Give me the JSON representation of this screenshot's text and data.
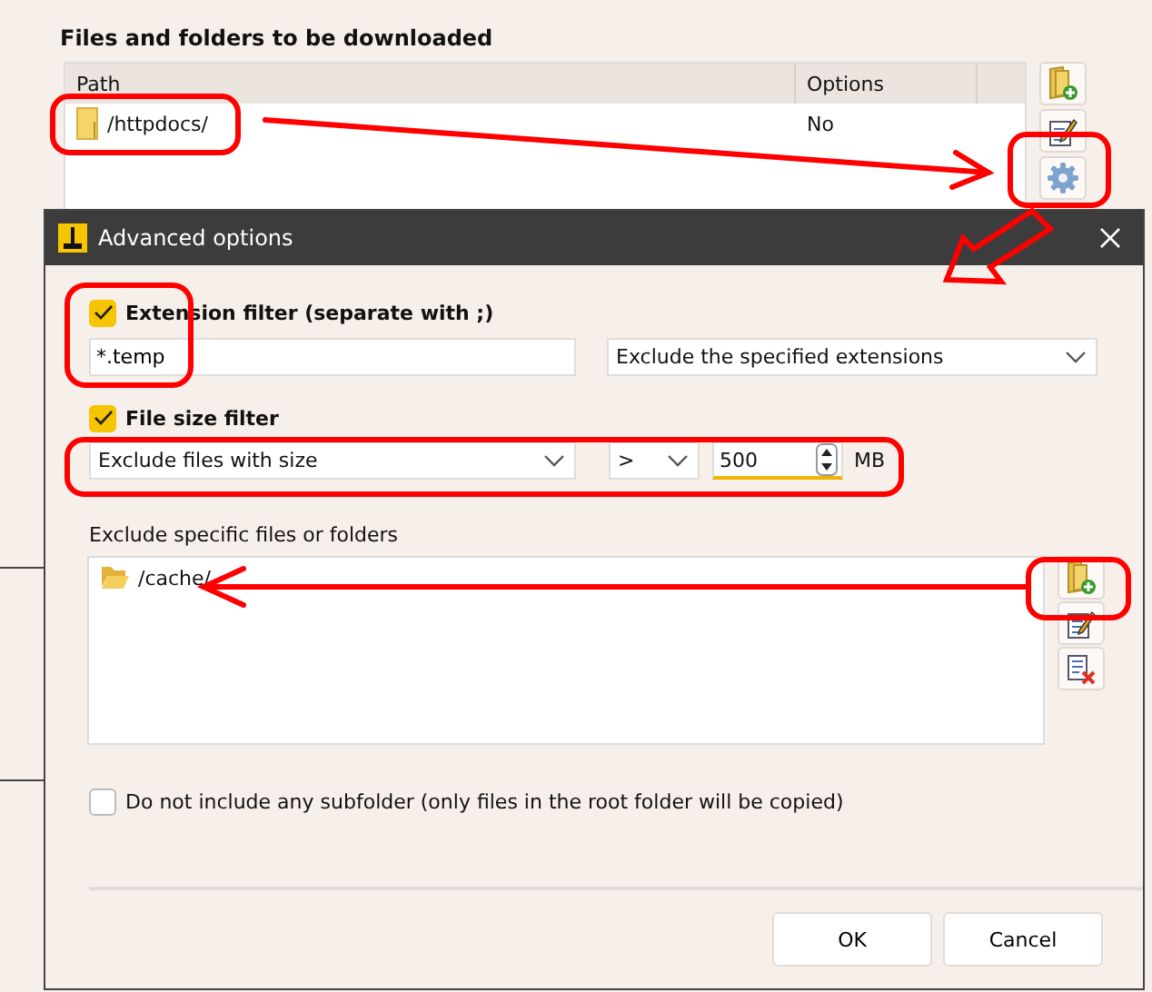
{
  "background_window": {
    "section_title": "Files and folders to be downloaded",
    "table": {
      "columns": [
        "Path",
        "Options"
      ],
      "rows": [
        {
          "path": "/httpdocs/",
          "options": "No"
        }
      ]
    }
  },
  "dialog": {
    "title": "Advanced options",
    "extension_filter": {
      "label": "Extension filter (separate with ;)",
      "checked": true,
      "value": "*.temp",
      "mode": "Exclude the specified extensions"
    },
    "size_filter": {
      "label": "File size filter",
      "checked": true,
      "mode": "Exclude files with size",
      "operator": ">",
      "value": "500",
      "unit": "MB"
    },
    "exclusions": {
      "label": "Exclude specific files or folders",
      "items": [
        {
          "path": "/cache/"
        }
      ]
    },
    "no_subfolder": {
      "label": "Do not include any subfolder (only files in the root folder will be copied)",
      "checked": false
    },
    "buttons": [
      "OK",
      "Cancel"
    ]
  }
}
